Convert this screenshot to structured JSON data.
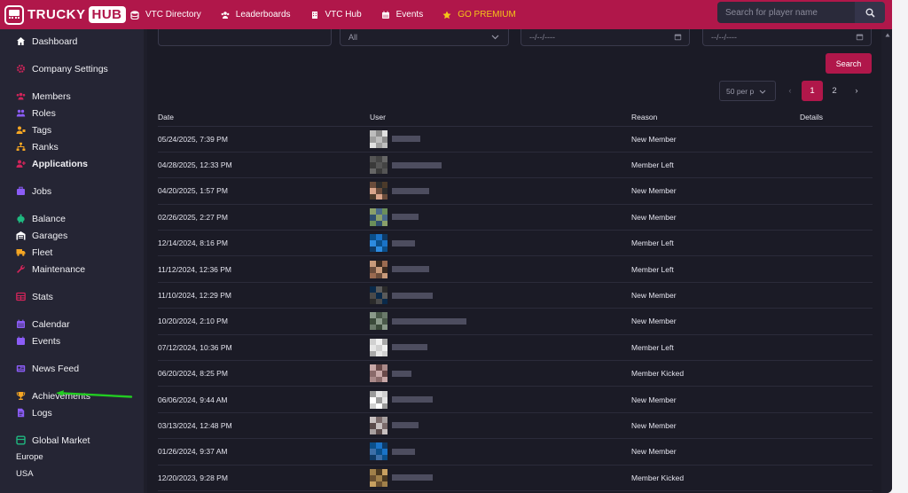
{
  "brand": {
    "name": "TRUCKY",
    "hub": "HUB"
  },
  "nav": [
    {
      "label": "VTC Directory",
      "icon": "database-icon"
    },
    {
      "label": "Leaderboards",
      "icon": "users-icon"
    },
    {
      "label": "VTC Hub",
      "icon": "building-icon"
    },
    {
      "label": "Events",
      "icon": "calendar-icon"
    },
    {
      "label": "GO PREMIUM",
      "icon": "star-icon"
    }
  ],
  "search": {
    "placeholder": "Search for player name"
  },
  "sidebar": {
    "dashboard": "Dashboard",
    "company_settings": "Company Settings",
    "members": "Members",
    "roles": "Roles",
    "tags": "Tags",
    "ranks": "Ranks",
    "applications": "Applications",
    "jobs": "Jobs",
    "balance": "Balance",
    "garages": "Garages",
    "fleet": "Fleet",
    "maintenance": "Maintenance",
    "stats": "Stats",
    "calendar": "Calendar",
    "events": "Events",
    "news_feed": "News Feed",
    "achievements": "Achievements",
    "logs": "Logs",
    "global_market": "Global Market",
    "europe": "Europe",
    "usa": "USA"
  },
  "filters": {
    "type_value": "All",
    "date_from_placeholder": "--/--/----",
    "date_to_placeholder": "--/--/----",
    "search_button": "Search",
    "per_page": "50 per p"
  },
  "pagination": {
    "prev": "‹",
    "page1": "1",
    "page2": "2",
    "next": "›"
  },
  "table": {
    "headers": {
      "date": "Date",
      "user": "User",
      "reason": "Reason",
      "details": "Details"
    },
    "rows": [
      {
        "date": "05/24/2025, 7:39 PM",
        "reason": "New Member"
      },
      {
        "date": "04/28/2025, 12:33 PM",
        "reason": "Member Left"
      },
      {
        "date": "04/20/2025, 1:57 PM",
        "reason": "New Member"
      },
      {
        "date": "02/26/2025, 2:27 PM",
        "reason": "New Member"
      },
      {
        "date": "12/14/2024, 8:16 PM",
        "reason": "Member Left"
      },
      {
        "date": "11/12/2024, 12:36 PM",
        "reason": "Member Left"
      },
      {
        "date": "11/10/2024, 12:29 PM",
        "reason": "New Member"
      },
      {
        "date": "10/20/2024, 2:10 PM",
        "reason": "New Member"
      },
      {
        "date": "07/12/2024, 10:36 PM",
        "reason": "Member Left"
      },
      {
        "date": "06/20/2024, 8:25 PM",
        "reason": "Member Kicked"
      },
      {
        "date": "06/06/2024, 9:44 AM",
        "reason": "New Member"
      },
      {
        "date": "03/13/2024, 12:48 PM",
        "reason": "New Member"
      },
      {
        "date": "01/26/2024, 9:37 AM",
        "reason": "New Member"
      },
      {
        "date": "12/20/2023, 9:28 PM",
        "reason": "Member Kicked"
      }
    ]
  },
  "colors": {
    "brand": "#b0174a",
    "sidebar": "#252534",
    "content": "#1b1b26",
    "premium": "#f5c518",
    "arrow": "#22cc22"
  }
}
